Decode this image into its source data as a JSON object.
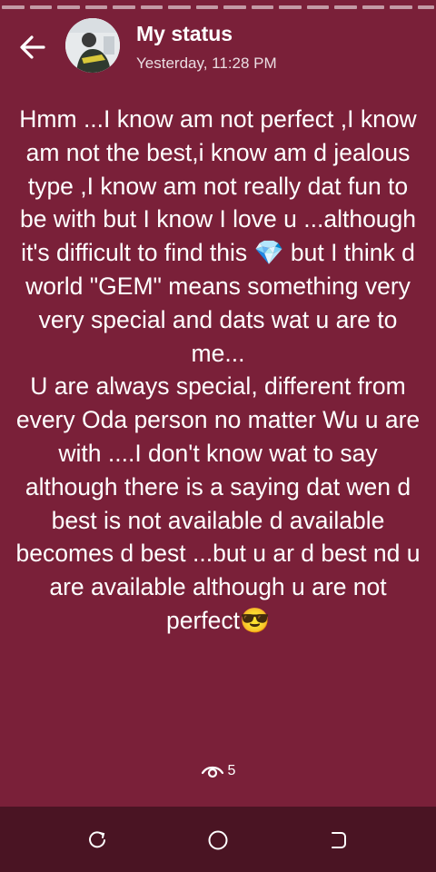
{
  "header": {
    "title": "My status",
    "timestamp": "Yesterday, 11:28 PM"
  },
  "status": {
    "text": "Hmm ...I know am not perfect ,I know am not the best,i know am d jealous type ,I know am not really dat fun to be with but I know I love u ...although it's difficult to find this 💎 but I think d world \"GEM\" means something very very special and dats wat u are to me...\nU are always special, different from every Oda person  no matter Wu u are with ....I don't know wat to say although there is a saying dat wen d best is not available d available becomes d best ...but u ar d best nd u are available although u are not perfect😎"
  },
  "views": {
    "count": "5",
    "icon": "eye-icon"
  },
  "icons": {
    "back": "arrow-left-icon",
    "nav_recent": "recent-apps-icon",
    "nav_home": "home-icon",
    "nav_back": "back-nav-icon"
  },
  "colors": {
    "background": "#7a2039",
    "navbar": "#4a1423"
  }
}
